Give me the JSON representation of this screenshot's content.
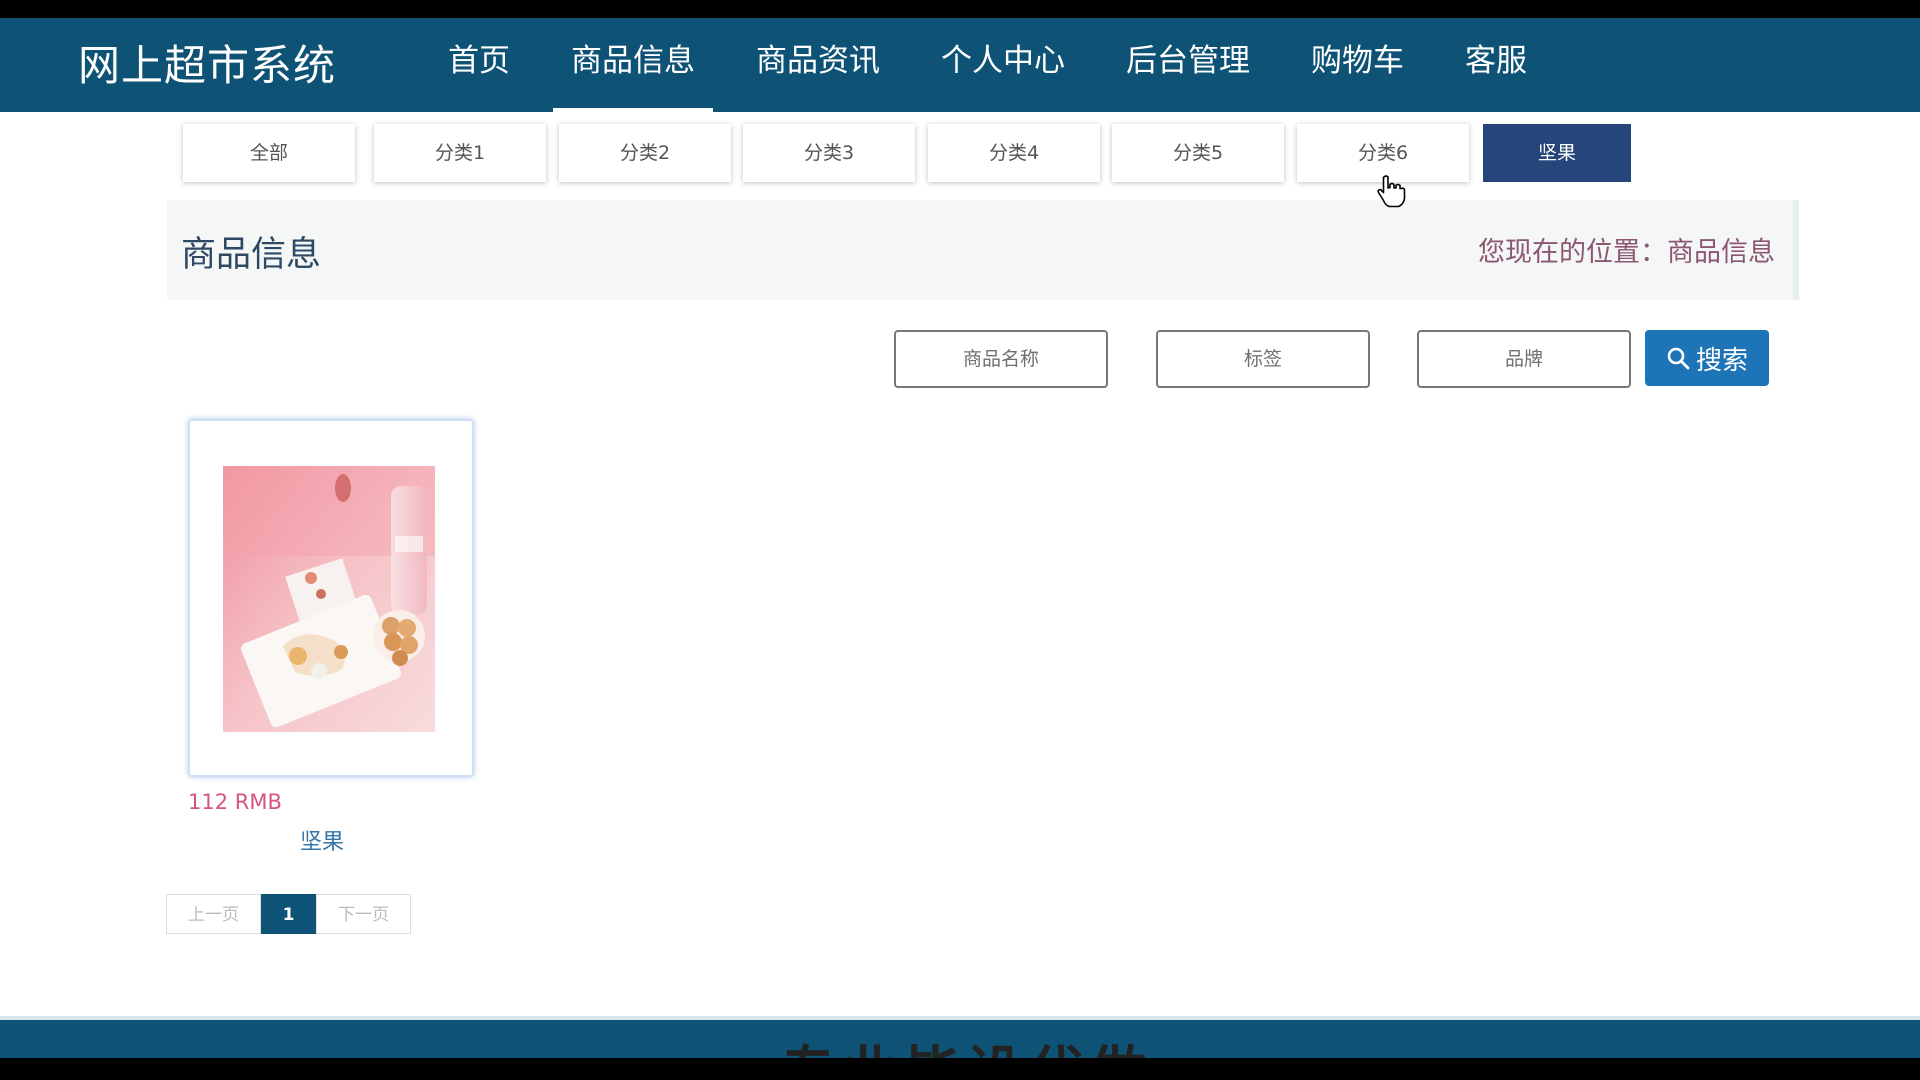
{
  "brand": "网上超市系统",
  "nav": {
    "items": [
      "首页",
      "商品信息",
      "商品资讯",
      "个人中心",
      "后台管理",
      "购物车",
      "客服"
    ],
    "active": "商品信息"
  },
  "categories": [
    "全部",
    "分类1",
    "分类2",
    "分类3",
    "分类4",
    "分类5",
    "分类6",
    "坚果"
  ],
  "active_category": "坚果",
  "page_title": "商品信息",
  "location": "您现在的位置：商品信息",
  "search": {
    "name_placeholder": "商品名称",
    "tag_placeholder": "标签",
    "brand_placeholder": "品牌",
    "button_label": "搜索"
  },
  "products": [
    {
      "price": "112 RMB",
      "name": "坚果"
    }
  ],
  "pagination": {
    "prev": "上一页",
    "current": "1",
    "next": "下一页"
  },
  "footer_text": "专业毕设代做",
  "colors": {
    "nav_bg": "#0e5276",
    "active_tab": "#26457a",
    "search_button": "#1d75b7",
    "price": "#d6557d",
    "product_name": "#3477a6",
    "location_text": "#8b5772"
  }
}
